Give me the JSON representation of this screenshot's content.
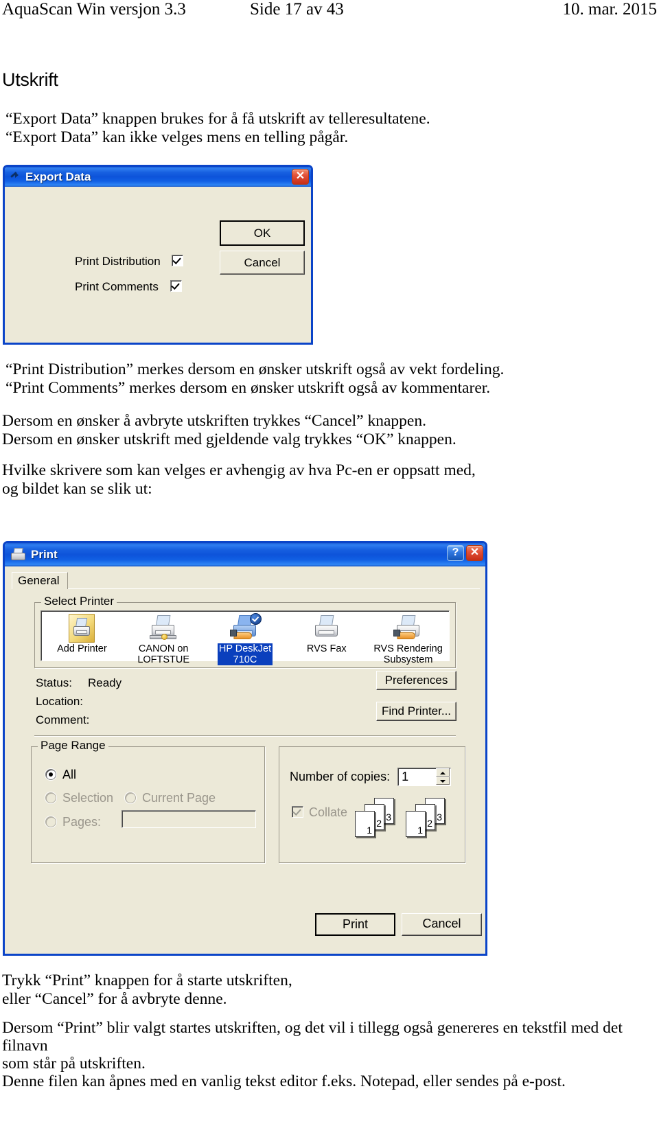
{
  "header": {
    "left": "AquaScan Win versjon 3.3",
    "center": "Side 17 av 43",
    "right": "10. mar. 2015"
  },
  "section": {
    "title": "Utskrift",
    "intro": "“Export Data” knappen brukes for å få utskrift av telleresultatene.\n“Export Data” kan ikke velges mens en telling pågår.",
    "after_export_1": "“Print Distribution” merkes dersom en ønsker utskrift også av vekt fordeling.\n“Print Comments” merkes dersom en ønsker utskrift også av kommentarer.",
    "after_export_2": "Dersom en ønsker å avbryte utskriften trykkes “Cancel” knappen.\nDersom en ønsker utskrift med gjeldende valg trykkes “OK” knappen.",
    "after_export_3": "Hvilke skrivere som kan velges er avhengig av hva Pc-en er oppsatt med,\nog bildet kan se slik ut:",
    "tail_1": "Trykk “Print” knappen for å starte utskriften,\neller “Cancel” for å avbryte denne.",
    "tail_2": "Dersom “Print” blir valgt startes utskriften, og det vil i tillegg også genereres en tekstfil med det filnavn\nsom står på utskriften.\nDenne filen kan åpnes med en vanlig tekst editor f.eks. Notepad, eller sendes på e-post."
  },
  "export_dialog": {
    "title": "Export Data",
    "close_glyph": "✕",
    "ok_label": "OK",
    "cancel_label": "Cancel",
    "print_distribution_label": "Print Distribution",
    "print_comments_label": "Print Comments"
  },
  "print_dialog": {
    "title": "Print",
    "help_glyph": "?",
    "close_glyph": "✕",
    "tab_general": "General",
    "select_printer_label": "Select Printer",
    "printers": [
      {
        "label": "Add Printer",
        "selected": false
      },
      {
        "label": "CANON on\nLOFTSTUE",
        "selected": false
      },
      {
        "label": "HP DeskJet\n710C",
        "selected": true
      },
      {
        "label": "RVS Fax",
        "selected": false
      },
      {
        "label": "RVS Rendering\nSubsystem",
        "selected": false
      }
    ],
    "status_label": "Status:",
    "status_value": "Ready",
    "location_label": "Location:",
    "location_value": "",
    "comment_label": "Comment:",
    "comment_value": "",
    "preferences_label": "Preferences",
    "find_printer_label": "Find Printer...",
    "page_range_label": "Page Range",
    "range_all": "All",
    "range_selection": "Selection",
    "range_current_page": "Current Page",
    "range_pages": "Pages:",
    "pages_value": "",
    "copies_label": "Number of copies:",
    "copies_value": "1",
    "collate_label": "Collate",
    "collate_pages": [
      "1",
      "2",
      "3"
    ],
    "print_label": "Print",
    "cancel_label": "Cancel"
  },
  "colors": {
    "title_blue": "#0d53da",
    "dialog_face": "#ece9d8",
    "selection_blue": "#0a3fbd",
    "close_red": "#c62d16"
  }
}
